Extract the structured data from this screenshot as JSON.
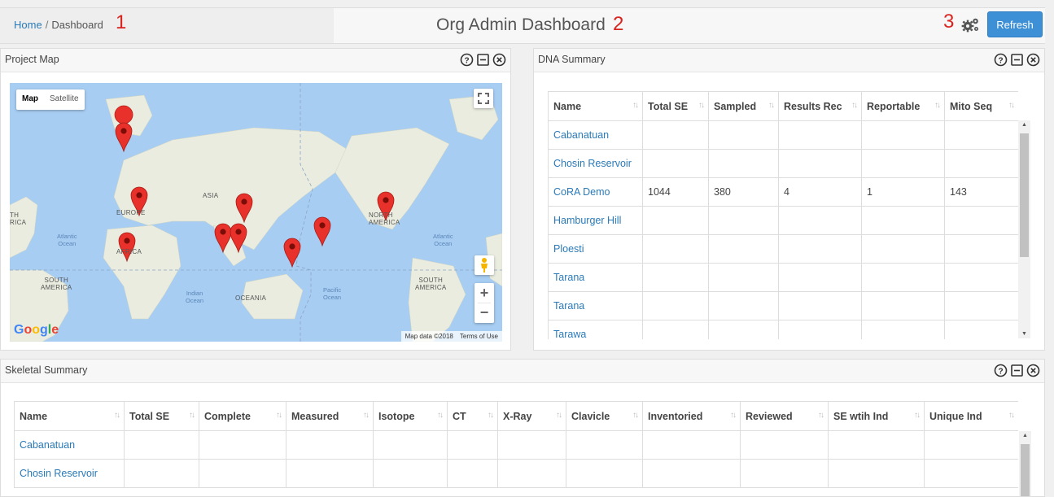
{
  "breadcrumb": {
    "home": "Home",
    "separator": "/",
    "current": "Dashboard"
  },
  "page_title": "Org Admin Dashboard",
  "markers": [
    "1",
    "2",
    "3"
  ],
  "toolbar": {
    "settings_icon": "gears-icon",
    "refresh_label": "Refresh"
  },
  "project_map": {
    "title": "Project Map",
    "map_type": {
      "map": "Map",
      "satellite": "Satellite"
    },
    "labels": {
      "asia": "ASIA",
      "europe": "EUROPE",
      "africa": "AFRICA",
      "north_america": "NORTH\nAMERICA",
      "north_america_left": "TH\nRICA",
      "south_america_left": "SOUTH\nAMERICA",
      "south_america_right": "SOUTH\nAMERICA",
      "oceania": "OCEANIA"
    },
    "oceans": {
      "atlantic_left": "Atlantic\nOcean",
      "atlantic_right": "Atlantic\nOcean",
      "indian": "Indian\nOcean",
      "pacific": "Pacific\nOcean"
    },
    "brand": "Google",
    "attribution": {
      "data": "Map data ©2018",
      "terms": "Terms of Use"
    },
    "zoom_in": "+",
    "zoom_out": "−"
  },
  "dna_summary": {
    "title": "DNA Summary",
    "columns": [
      "Name",
      "Total SE",
      "Sampled",
      "Results Rec",
      "Reportable",
      "Mito Seq"
    ],
    "rows": [
      [
        "Cabanatuan",
        "",
        "",
        "",
        "",
        ""
      ],
      [
        "Chosin Reservoir",
        "",
        "",
        "",
        "",
        ""
      ],
      [
        "CoRA Demo",
        "1044",
        "380",
        "4",
        "1",
        "143"
      ],
      [
        "Hamburger Hill",
        "",
        "",
        "",
        "",
        ""
      ],
      [
        "Ploesti",
        "",
        "",
        "",
        "",
        ""
      ],
      [
        "Tarana",
        "",
        "",
        "",
        "",
        ""
      ],
      [
        "Tarana",
        "",
        "",
        "",
        "",
        ""
      ],
      [
        "Tarawa",
        "",
        "",
        "",
        "",
        ""
      ]
    ]
  },
  "skeletal_summary": {
    "title": "Skeletal Summary",
    "columns": [
      "Name",
      "Total SE",
      "Complete",
      "Measured",
      "Isotope",
      "CT",
      "X-Ray",
      "Clavicle",
      "Inventoried",
      "Reviewed",
      "SE wtih Ind",
      "Unique Ind"
    ],
    "rows": [
      [
        "Cabanatuan",
        "",
        "",
        "",
        "",
        "",
        "",
        "",
        "",
        "",
        "",
        ""
      ],
      [
        "Chosin Reservoir",
        "",
        "",
        "",
        "",
        "",
        "",
        "",
        "",
        "",
        "",
        ""
      ]
    ]
  },
  "colors": {
    "accent": "#3d8fd6",
    "link": "#2a7ab8",
    "marker": "#d9231f",
    "map_pin": "#e8312a"
  }
}
